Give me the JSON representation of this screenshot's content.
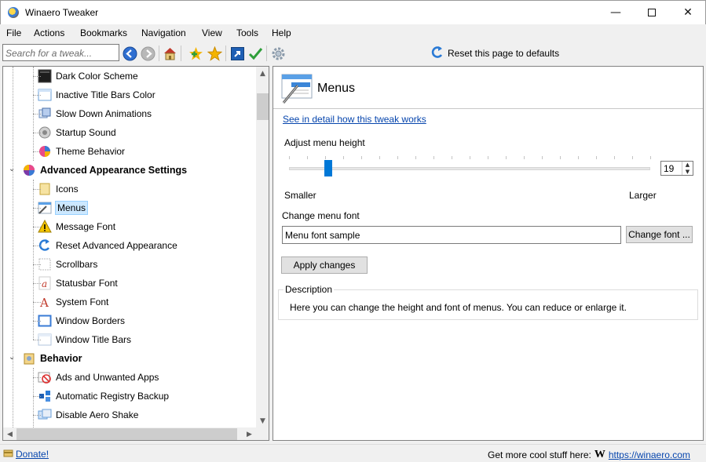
{
  "window": {
    "title": "Winaero Tweaker",
    "icon": "winaero-icon"
  },
  "menubar": [
    "File",
    "Actions",
    "Bookmarks",
    "Navigation",
    "View",
    "Tools",
    "Help"
  ],
  "toolbar": {
    "search_placeholder": "Search for a tweak...",
    "icons": [
      "back-icon",
      "forward-icon",
      "home-icon",
      "add-bookmark-icon",
      "bookmarks-star-icon",
      "open-regedit-icon",
      "apply-check-icon",
      "settings-gear-icon"
    ],
    "reset_label": "Reset this page to defaults"
  },
  "tree": {
    "items": [
      {
        "label": "Dark Color Scheme",
        "icon": "dark-scheme-icon",
        "kind": "item"
      },
      {
        "label": "Inactive Title Bars Color",
        "icon": "window-icon",
        "kind": "item"
      },
      {
        "label": "Slow Down Animations",
        "icon": "animation-icon",
        "kind": "item"
      },
      {
        "label": "Startup Sound",
        "icon": "speaker-icon",
        "kind": "item"
      },
      {
        "label": "Theme Behavior",
        "icon": "theme-icon",
        "kind": "item"
      },
      {
        "label": "Advanced Appearance Settings",
        "icon": "appearance-icon",
        "kind": "category"
      },
      {
        "label": "Icons",
        "icon": "folder-icon",
        "kind": "item"
      },
      {
        "label": "Menus",
        "icon": "menus-icon",
        "kind": "item",
        "selected": true
      },
      {
        "label": "Message Font",
        "icon": "warning-icon",
        "kind": "item"
      },
      {
        "label": "Reset Advanced Appearance",
        "icon": "reset-icon",
        "kind": "item"
      },
      {
        "label": "Scrollbars",
        "icon": "scrollbar-icon",
        "kind": "item"
      },
      {
        "label": "Statusbar Font",
        "icon": "font-icon",
        "kind": "item"
      },
      {
        "label": "System Font",
        "icon": "font-a-icon",
        "kind": "item"
      },
      {
        "label": "Window Borders",
        "icon": "border-icon",
        "kind": "item"
      },
      {
        "label": "Window Title Bars",
        "icon": "titlebar-icon",
        "kind": "item"
      },
      {
        "label": "Behavior",
        "icon": "behavior-icon",
        "kind": "category"
      },
      {
        "label": "Ads and Unwanted Apps",
        "icon": "ads-icon",
        "kind": "item"
      },
      {
        "label": "Automatic Registry Backup",
        "icon": "registry-icon",
        "kind": "item"
      },
      {
        "label": "Disable Aero Shake",
        "icon": "aero-shake-icon",
        "kind": "item"
      }
    ]
  },
  "content": {
    "title": "Menus",
    "detail_link": "See in detail how this tweak works",
    "height_label": "Adjust menu height",
    "slider_min_label": "Smaller",
    "slider_max_label": "Larger",
    "menu_height": "19",
    "slider_fraction": 0.1,
    "font_label": "Change menu font",
    "font_sample": "Menu font sample",
    "change_font_button": "Change font ...",
    "apply_button": "Apply changes",
    "description_legend": "Description",
    "description_text": "Here you can change the height and font of menus. You can reduce or enlarge it."
  },
  "statusbar": {
    "donate": "Donate!",
    "promo": "Get more cool stuff here:",
    "logo_letter": "W",
    "url": "https://winaero.com"
  },
  "colors": {
    "accent": "#0078d7",
    "link": "#0645ad",
    "selection": "#cce8ff"
  }
}
